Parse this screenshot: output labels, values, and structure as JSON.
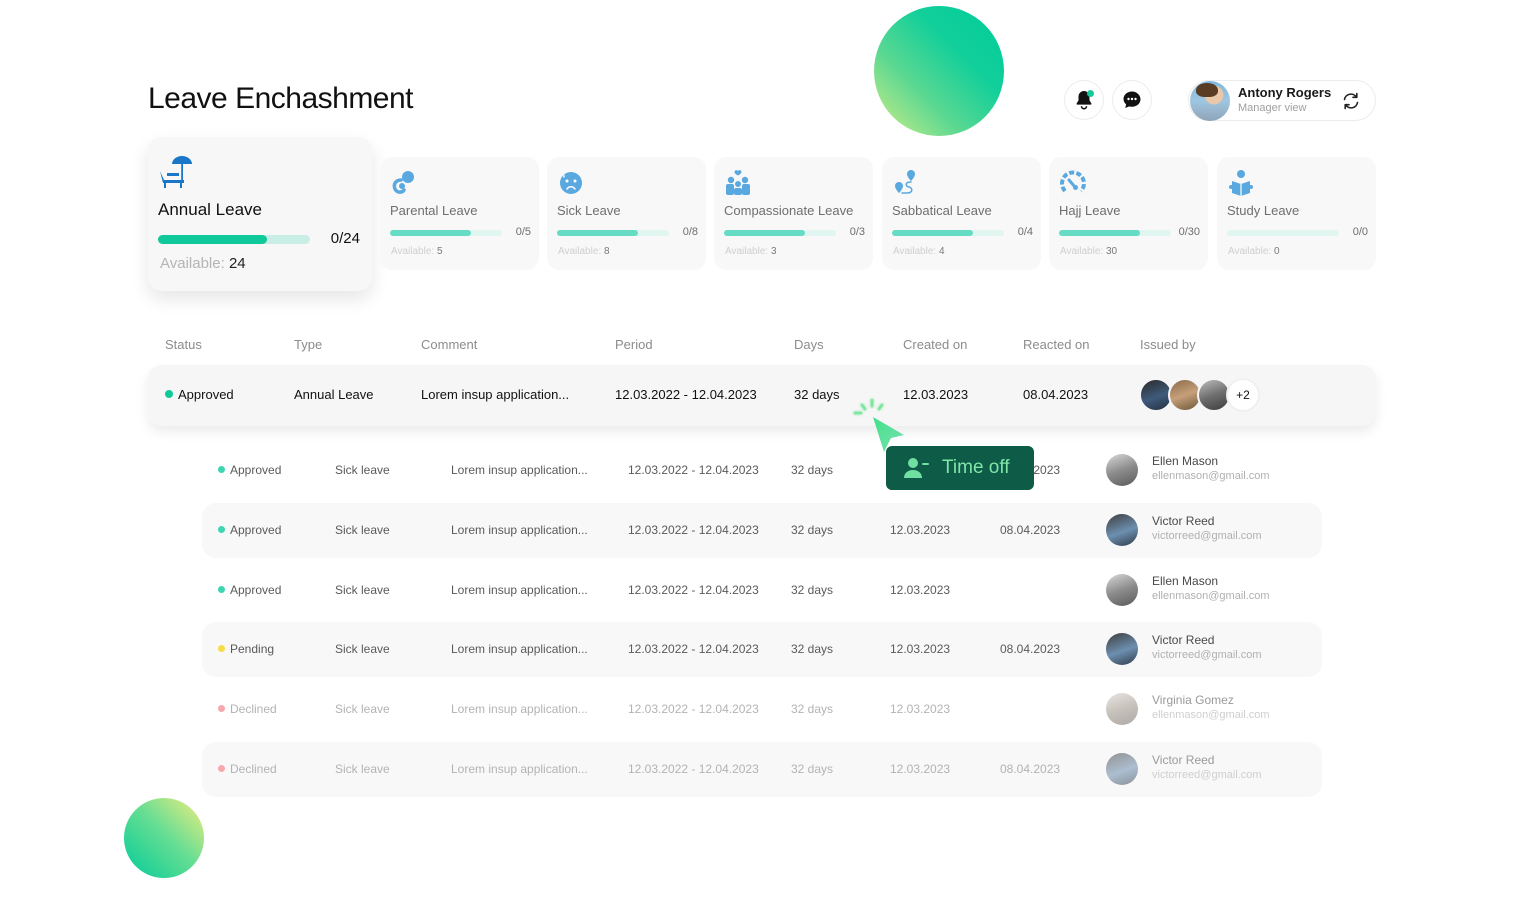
{
  "page": {
    "title": "Leave Enchashment"
  },
  "header": {
    "notifications_icon": "bell-icon",
    "has_unread_notifications": true,
    "messages_icon": "chat-bubble-icon",
    "user": {
      "name": "Antony Rogers",
      "role": "Manager view",
      "switch_icon": "refresh-icon"
    }
  },
  "leave_cards": [
    {
      "title": "Annual Leave",
      "icon": "beach-chair-umbrella-icon",
      "used": 0,
      "total": 24,
      "count_label": "0/24",
      "available_label": "Available:",
      "available": "24",
      "bar_fill": 0.72,
      "selected": true
    },
    {
      "title": "Parental Leave",
      "icon": "pacifier-icon",
      "used": 0,
      "total": 5,
      "count_label": "0/5",
      "available_label": "Available:",
      "available": "5",
      "bar_fill": 0.72
    },
    {
      "title": "Sick Leave",
      "icon": "sick-face-icon",
      "used": 0,
      "total": 8,
      "count_label": "0/8",
      "available_label": "Available:",
      "available": "8",
      "bar_fill": 0.72
    },
    {
      "title": "Compassionate Leave",
      "icon": "family-heart-icon",
      "used": 0,
      "total": 3,
      "count_label": "0/3",
      "available_label": "Available:",
      "available": "3",
      "bar_fill": 0.72
    },
    {
      "title": "Sabbatical Leave",
      "icon": "route-pin-icon",
      "used": 0,
      "total": 4,
      "count_label": "0/4",
      "available_label": "Available:",
      "available": "4",
      "bar_fill": 0.72
    },
    {
      "title": "Hajj Leave",
      "icon": "dial-gauge-icon",
      "used": 0,
      "total": 30,
      "count_label": "0/30",
      "available_label": "Available:",
      "available": "30",
      "bar_fill": 0.72
    },
    {
      "title": "Study Leave",
      "icon": "reading-person-icon",
      "used": 0,
      "total": 0,
      "count_label": "0/0",
      "available_label": "Available:",
      "available": "0",
      "bar_fill": 0
    }
  ],
  "table": {
    "columns": [
      "Status",
      "Type",
      "Comment",
      "Period",
      "Days",
      "Created on",
      "Reacted on",
      "Issued by"
    ],
    "main_row": {
      "status": "Approved",
      "status_color": "#10c99a",
      "type": "Annual Leave",
      "comment": "Lorem insup application...",
      "period": "12.03.2022 - 12.04.2023",
      "days": "32 days",
      "created_on": "12.03.2023",
      "reacted_on": "08.04.2023",
      "issued_by_extra": "+2"
    },
    "sub_rows": [
      {
        "status": "Approved",
        "status_color": "#3ed6b2",
        "type": "Sick leave",
        "comment": "Lorem insup application...",
        "period": "12.03.2022 - 12.04.2023",
        "days": "32 days",
        "created_on": "",
        "reacted_on": "08.04.2023",
        "reacted_on_visible": "2023",
        "person_name": "Ellen Mason",
        "person_email": "ellenmason@gmail.com"
      },
      {
        "status": "Approved",
        "status_color": "#3ed6b2",
        "type": "Sick leave",
        "comment": "Lorem insup application...",
        "period": "12.03.2022 - 12.04.2023",
        "days": "32 days",
        "created_on": "12.03.2023",
        "reacted_on": "08.04.2023",
        "person_name": "Victor Reed",
        "person_email": "victorreed@gmail.com"
      },
      {
        "status": "Approved",
        "status_color": "#3ed6b2",
        "type": "Sick leave",
        "comment": "Lorem insup application...",
        "period": "12.03.2022 - 12.04.2023",
        "days": "32 days",
        "created_on": "12.03.2023",
        "reacted_on": "",
        "person_name": "Ellen Mason",
        "person_email": "ellenmason@gmail.com"
      },
      {
        "status": "Pending",
        "status_color": "#f7dc4a",
        "type": "Sick leave",
        "comment": "Lorem insup application...",
        "period": "12.03.2022 - 12.04.2023",
        "days": "32 days",
        "created_on": "12.03.2023",
        "reacted_on": "08.04.2023",
        "person_name": "Victor Reed",
        "person_email": "victorreed@gmail.com"
      },
      {
        "status": "Declined",
        "status_color": "#f6a8ad",
        "type": "Sick leave",
        "comment": "Lorem insup application...",
        "period": "12.03.2022 - 12.04.2023",
        "days": "32 days",
        "created_on": "12.03.2023",
        "reacted_on": "",
        "person_name": "Virginia Gomez",
        "person_email": "ellenmason@gmail.com"
      },
      {
        "status": "Declined",
        "status_color": "#f6a8ad",
        "type": "Sick leave",
        "comment": "Lorem insup application...",
        "period": "12.03.2022 - 12.04.2023",
        "days": "32 days",
        "created_on": "12.03.2023",
        "reacted_on": "08.04.2023",
        "person_name": "Victor Reed",
        "person_email": "victorreed@gmail.com"
      }
    ]
  },
  "tooltip": {
    "label": "Time off",
    "icon": "user-minus-icon"
  },
  "colors": {
    "accent": "#10c99a",
    "icon_blue": "#5aa8e0",
    "tooltip_bg": "#0e5b47",
    "tooltip_text": "#7fe6a8"
  }
}
